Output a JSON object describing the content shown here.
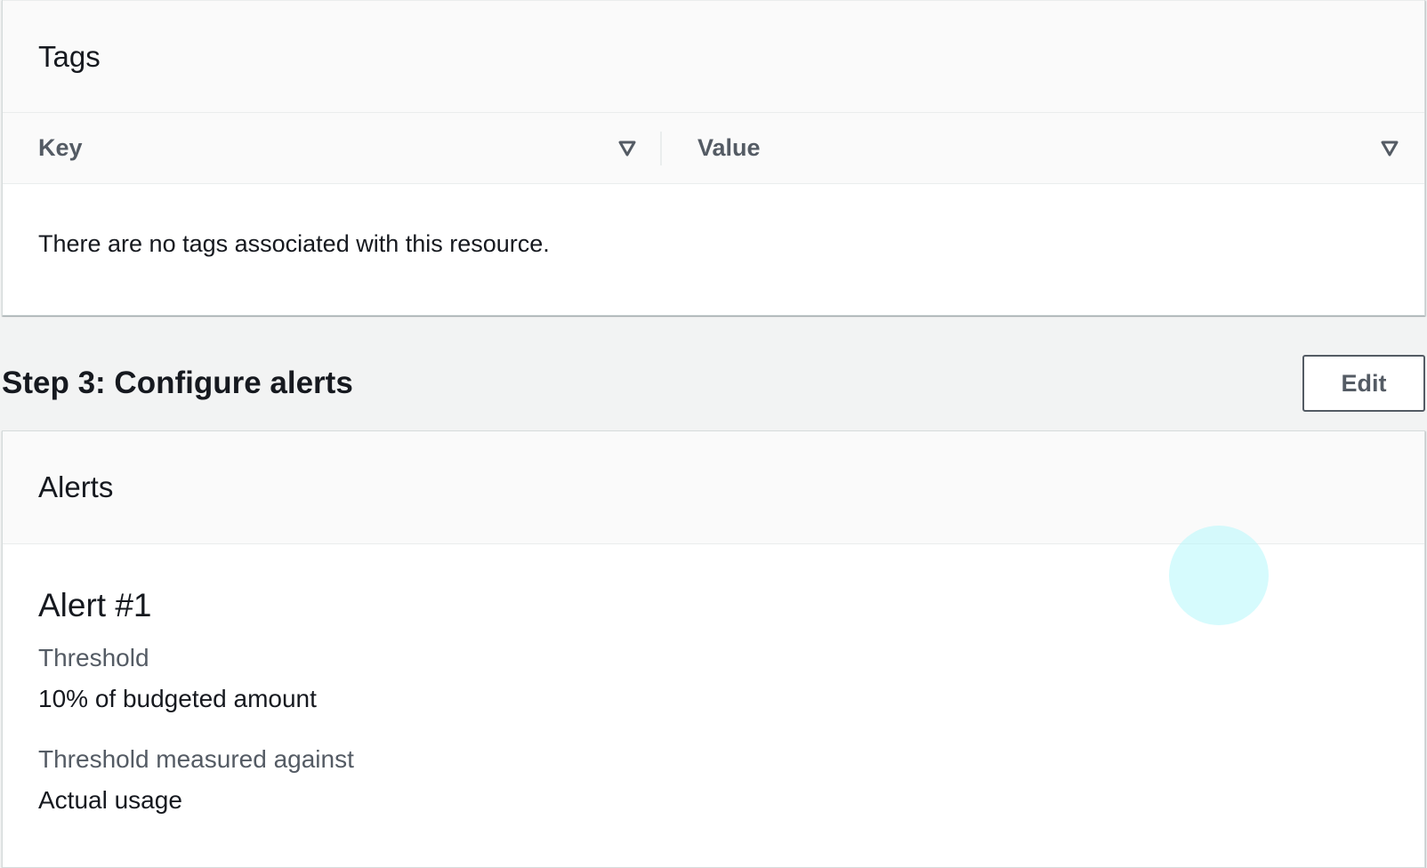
{
  "tags_panel": {
    "title": "Tags",
    "columns": [
      {
        "label": "Key",
        "icon": "sort-down-icon"
      },
      {
        "label": "Value",
        "icon": "sort-down-icon"
      }
    ],
    "empty_message": "There are no tags associated with this resource."
  },
  "step3": {
    "title": "Step 3: Configure alerts",
    "edit_label": "Edit"
  },
  "alerts_panel": {
    "title": "Alerts",
    "alert": {
      "title": "Alert #1",
      "fields": [
        {
          "key": "Threshold",
          "value": "10% of budgeted amount"
        },
        {
          "key": "Threshold measured against",
          "value": "Actual usage"
        }
      ]
    }
  },
  "colors": {
    "background": "#f2f3f3",
    "panel": "#ffffff",
    "header": "#fafafa",
    "muted_text": "#545b64",
    "text": "#16191f",
    "click_indicator": "#b4f8fc"
  }
}
